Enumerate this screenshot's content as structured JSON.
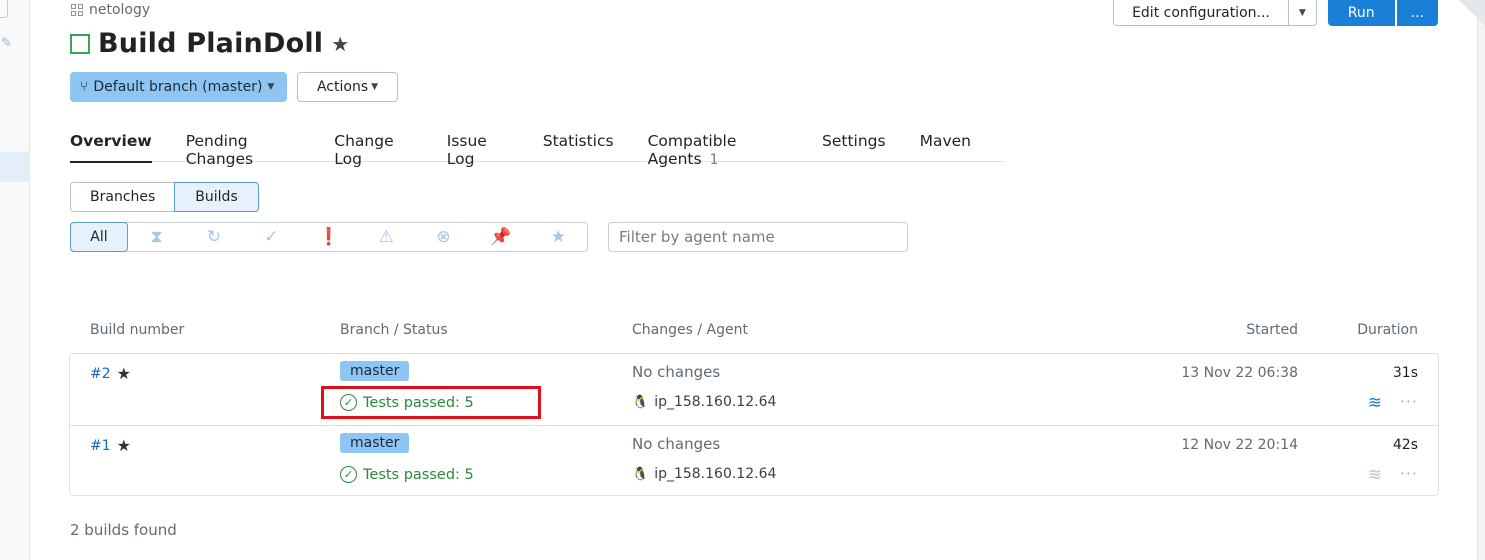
{
  "breadcrumb": "netology",
  "title": "Build PlainDoll",
  "header_buttons": {
    "edit": "Edit configuration...",
    "run": "Run",
    "more": "..."
  },
  "branch_button": "Default branch (master)",
  "actions_button": "Actions",
  "tabs": [
    {
      "label": "Overview",
      "active": true
    },
    {
      "label": "Pending Changes"
    },
    {
      "label": "Change Log"
    },
    {
      "label": "Issue Log"
    },
    {
      "label": "Statistics"
    },
    {
      "label": "Compatible Agents",
      "count": "1"
    },
    {
      "label": "Settings"
    },
    {
      "label": "Maven"
    }
  ],
  "view_toggle": [
    "Branches",
    "Builds"
  ],
  "filter": {
    "all": "All",
    "search_placeholder": "Filter by agent name"
  },
  "columns": {
    "build_number": "Build number",
    "branch_status": "Branch / Status",
    "changes_agent": "Changes / Agent",
    "started": "Started",
    "duration": "Duration"
  },
  "builds": [
    {
      "number": "#2",
      "branch": "master",
      "status": "Tests passed: 5",
      "changes": "No changes",
      "agent": "ip_158.160.12.64",
      "started": "13 Nov 22 06:38",
      "duration": "31s"
    },
    {
      "number": "#1",
      "branch": "master",
      "status": "Tests passed: 5",
      "changes": "No changes",
      "agent": "ip_158.160.12.64",
      "started": "12 Nov 22 20:14",
      "duration": "42s"
    }
  ],
  "footer": "2 builds found",
  "colors": {
    "accent": "#1a7fd6",
    "branch_badge": "#8fc5f3",
    "success": "#2a8a3c",
    "highlight": "#e0101a"
  }
}
